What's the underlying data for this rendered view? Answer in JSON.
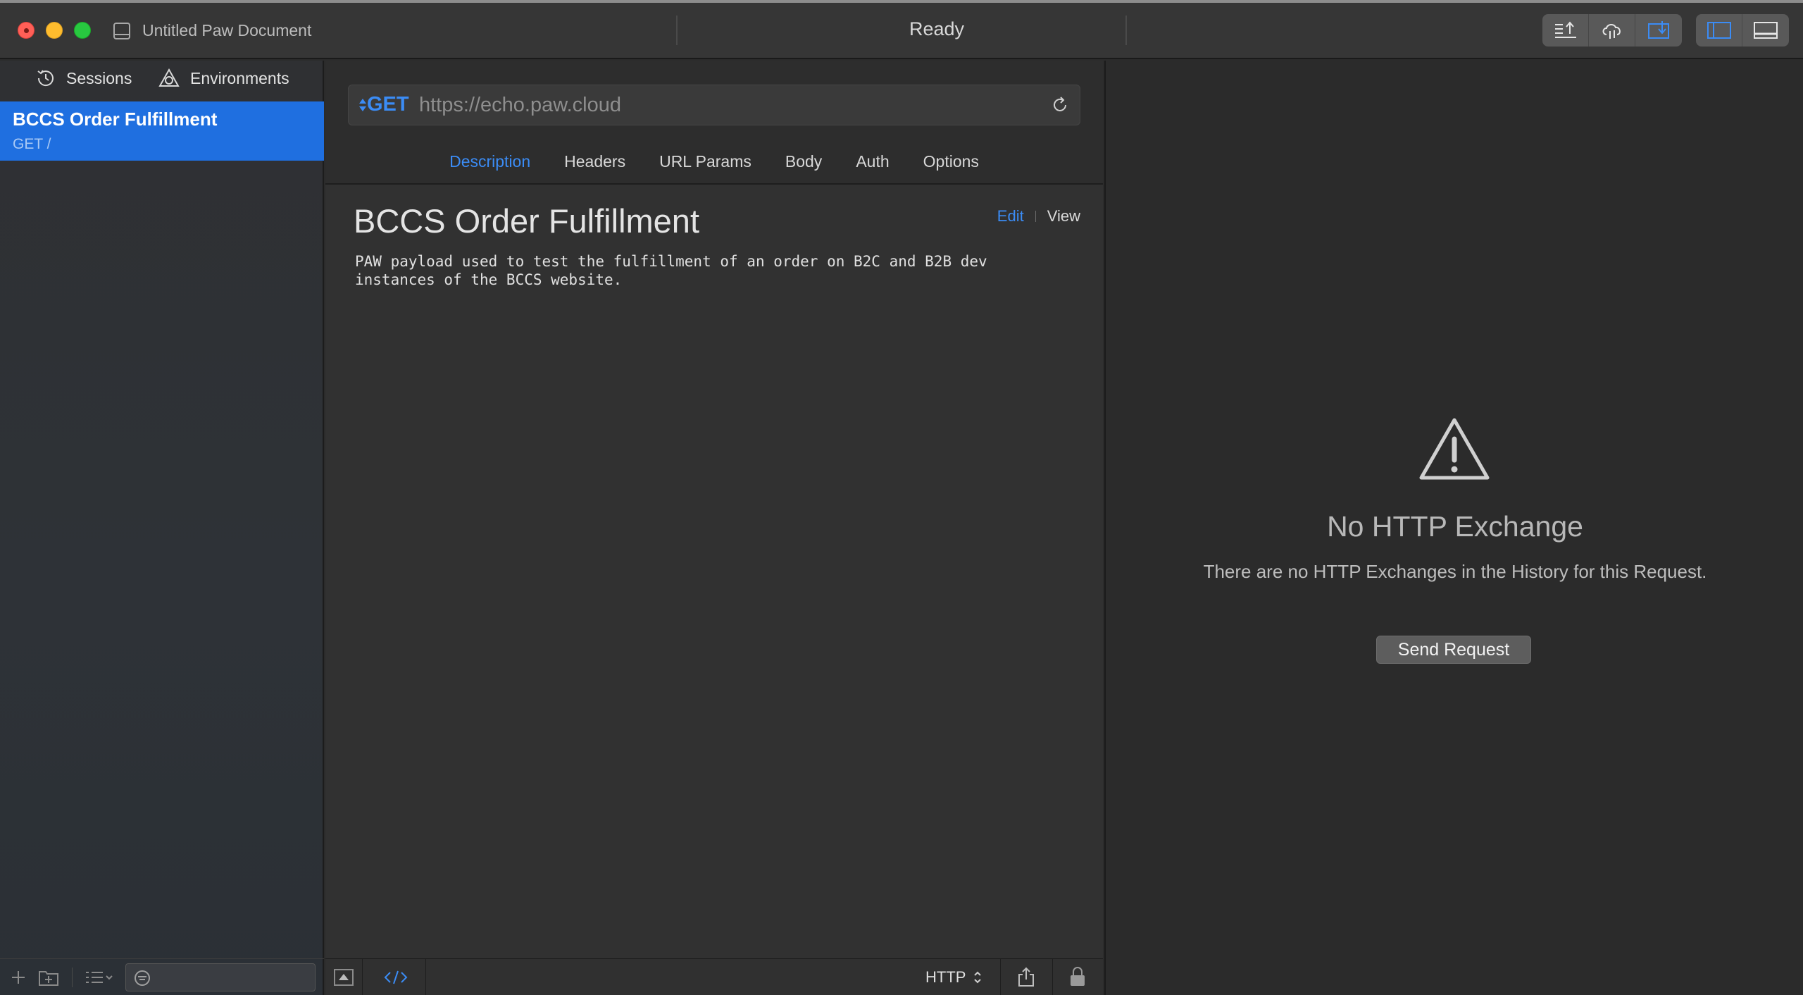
{
  "window": {
    "title": "Untitled Paw Document",
    "status": "Ready"
  },
  "toolbar": {
    "icons": [
      "export-icon",
      "cloud-sync-icon",
      "import-icon",
      "sidebar-toggle-icon",
      "bottom-panel-toggle-icon"
    ]
  },
  "sidebar": {
    "tabs": [
      {
        "label": "Sessions",
        "icon": "history-clock-icon"
      },
      {
        "label": "Environments",
        "icon": "environments-icon"
      }
    ],
    "requests": [
      {
        "name": "BCCS Order Fulfillment",
        "subtitle": "GET /"
      }
    ],
    "footer": {
      "search_placeholder": ""
    }
  },
  "request": {
    "method": "GET",
    "url": "https://echo.paw.cloud",
    "tabs": [
      "Description",
      "Headers",
      "URL Params",
      "Body",
      "Auth",
      "Options"
    ],
    "active_tab": "Description",
    "description": {
      "title": "BCCS Order Fulfillment",
      "edit_label": "Edit",
      "view_label": "View",
      "body": "PAW payload used to test the fulfillment of an order on B2C and B2B dev\ninstances of the BCCS website."
    },
    "footer": {
      "protocol": "HTTP"
    }
  },
  "response": {
    "empty_title": "No HTTP Exchange",
    "empty_message": "There are no HTTP Exchanges in the History for this Request.",
    "send_button": "Send Request"
  },
  "colors": {
    "accent": "#3b8cf5",
    "selection": "#1f6fe0"
  }
}
